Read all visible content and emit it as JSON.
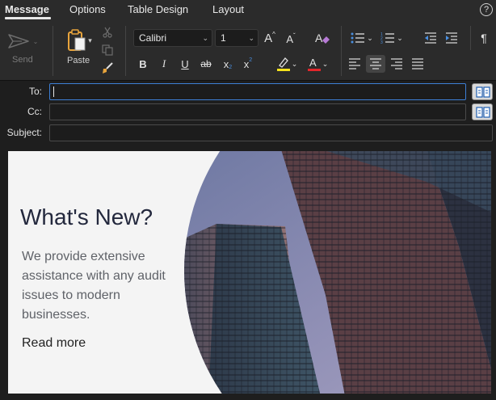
{
  "tabs": [
    {
      "label": "Message",
      "active": true
    },
    {
      "label": "Options"
    },
    {
      "label": "Table Design"
    },
    {
      "label": "Layout"
    }
  ],
  "help_label": "?",
  "ribbon": {
    "send_label": "Send",
    "paste_label": "Paste",
    "font_name": "Calibri",
    "font_size": "1",
    "bold": "B",
    "italic": "I",
    "underline": "U",
    "strikethrough": "ab",
    "subscript": "x",
    "subscript_mark": "2",
    "superscript": "x",
    "superscript_mark": "2",
    "grow_font": "A",
    "shrink_font": "A",
    "highlight": "A",
    "font_color": "A",
    "pilcrow": "¶",
    "highlight_color": "#f5e21c",
    "font_color_value": "#e3262b"
  },
  "header": {
    "to_label": "To:",
    "cc_label": "Cc:",
    "subject_label": "Subject:",
    "to_value": "",
    "cc_value": "",
    "subject_value": ""
  },
  "body": {
    "headline": "What's New?",
    "paragraph": "We provide extensive assistance with any audit issues to modern businesses.",
    "link": "Read more"
  },
  "colors": {
    "accent": "#3d7fd6",
    "headline": "#23283d"
  }
}
